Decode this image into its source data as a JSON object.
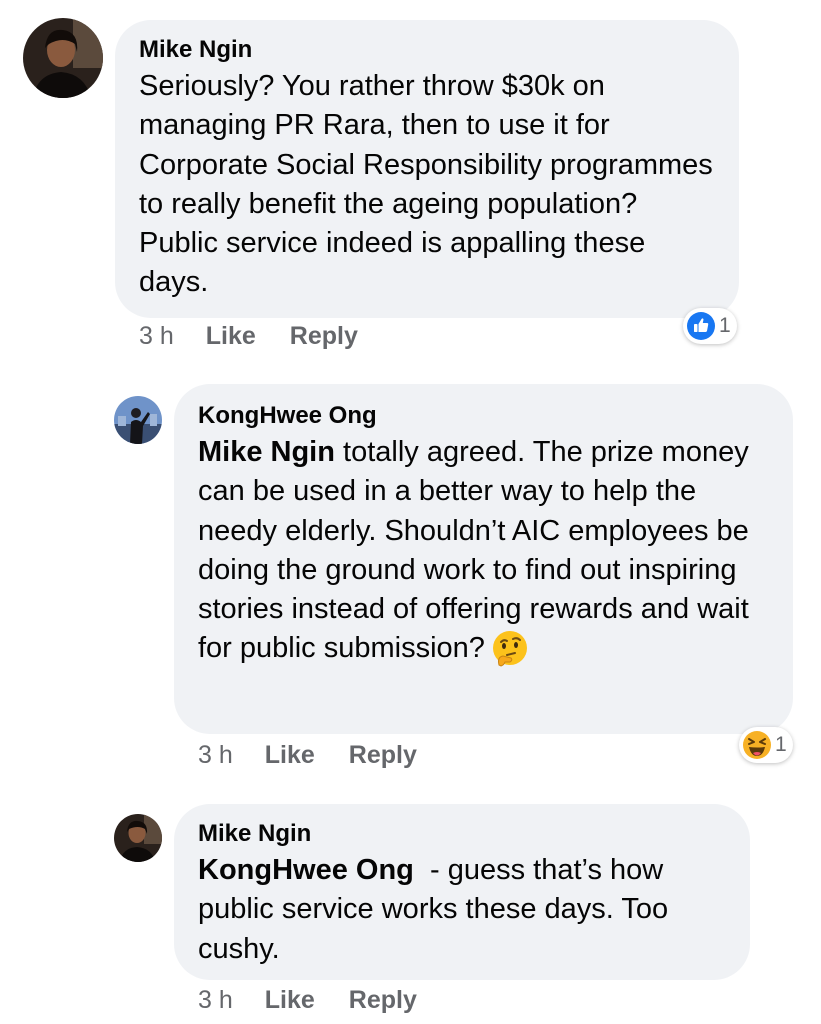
{
  "comments": [
    {
      "author": "Mike Ngin",
      "text": "Seriously? You rather throw $30k on managing PR Rara, then to use it for Corporate Social Responsibility programmes to really benefit the ageing population? Public service indeed is appalling these days.",
      "time": "3 h",
      "like_label": "Like",
      "reply_label": "Reply",
      "reaction": {
        "type": "like",
        "icon": "thumbs-up-icon",
        "count": "1",
        "color": "#1877f2"
      }
    },
    {
      "author": "KongHwee Ong",
      "mention": "Mike Ngin",
      "text": " totally agreed. The prize money can be used in a better way to help the needy elderly. Shouldn’t AIC employees be doing the ground work to find out inspiring stories instead of offering rewards and wait for public submission?",
      "emoji": "thinking-face-emoji",
      "time": "3 h",
      "like_label": "Like",
      "reply_label": "Reply",
      "reaction": {
        "type": "haha",
        "icon": "laughing-face-icon",
        "count": "1",
        "color": "#f7b125"
      }
    },
    {
      "author": "Mike Ngin",
      "mention": "KongHwee Ong",
      "text": "  - guess that’s how public service works these days. Too cushy.",
      "time": "3 h",
      "like_label": "Like",
      "reply_label": "Reply"
    }
  ]
}
